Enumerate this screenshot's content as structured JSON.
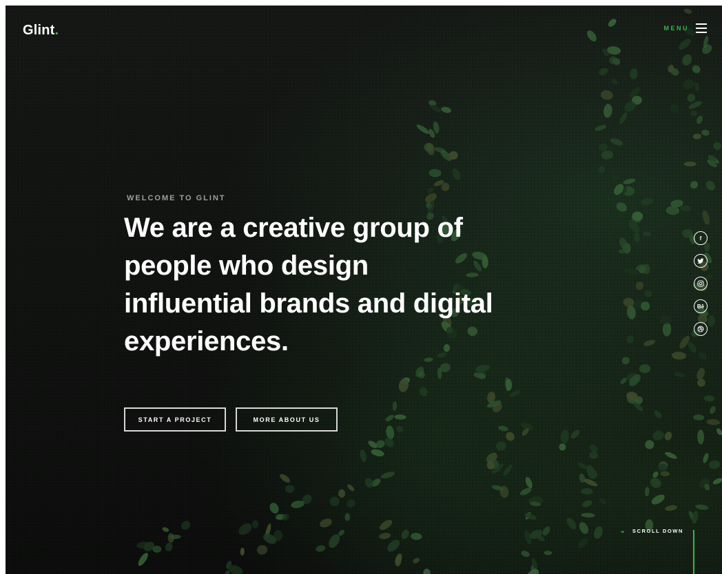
{
  "header": {
    "logo_text": "Glint",
    "logo_dot": ".",
    "menu_label": "MENU"
  },
  "hero": {
    "eyebrow": "WELCOME TO GLINT",
    "headline": "We are a creative group of people who design influential brands and digital experiences.",
    "buttons": [
      {
        "label": "START A PROJECT"
      },
      {
        "label": "MORE ABOUT US"
      }
    ]
  },
  "social": [
    {
      "icon": "facebook-icon",
      "label": "f"
    },
    {
      "icon": "twitter-icon",
      "label": ""
    },
    {
      "icon": "instagram-icon",
      "label": ""
    },
    {
      "icon": "behance-icon",
      "label": "Bē"
    },
    {
      "icon": "dribbble-icon",
      "label": ""
    }
  ],
  "scroll": {
    "label": "SCROLL DOWN",
    "chevron": "⌄"
  },
  "colors": {
    "accent": "#39b54a",
    "background": "#0d0f0e",
    "text": "#ffffff"
  }
}
